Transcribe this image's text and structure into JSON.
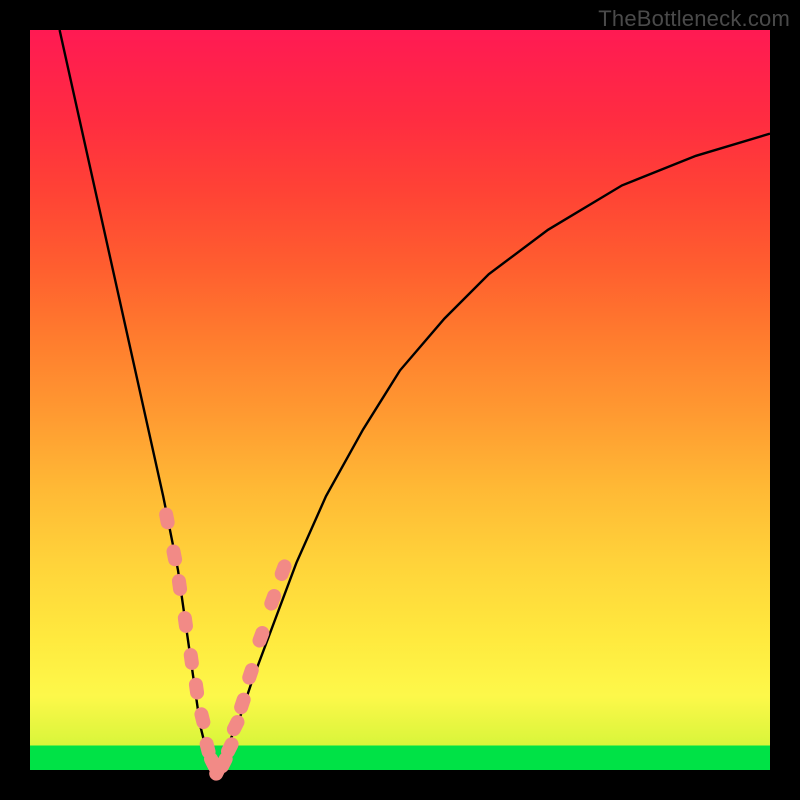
{
  "watermark": "TheBottleneck.com",
  "colors": {
    "background": "#000000",
    "curve": "#000000",
    "pill": "#f28a86",
    "green": "#00e246"
  },
  "chart_data": {
    "type": "line",
    "title": "",
    "xlabel": "",
    "ylabel": "",
    "xlim": [
      0,
      100
    ],
    "ylim": [
      0,
      100
    ],
    "notes": "V-shaped bottleneck curve on red→yellow→green vertical gradient. Pink lozenge markers clustered near the valley on both arms. No tick labels or axis text visible.",
    "series": [
      {
        "name": "curve",
        "x": [
          4,
          6,
          8,
          10,
          12,
          14,
          16,
          18,
          20,
          21,
          22,
          23,
          24,
          25,
          26,
          28,
          30,
          33,
          36,
          40,
          45,
          50,
          56,
          62,
          70,
          80,
          90,
          100
        ],
        "values": [
          100,
          91,
          82,
          73,
          64,
          55,
          46,
          37,
          27,
          20,
          13,
          6,
          2,
          0,
          2,
          6,
          12,
          20,
          28,
          37,
          46,
          54,
          61,
          67,
          73,
          79,
          83,
          86
        ]
      }
    ],
    "markers": {
      "name": "pills",
      "x": [
        18.5,
        19.5,
        20.2,
        21.0,
        21.8,
        22.5,
        23.3,
        24.0,
        24.7,
        25.4,
        26.2,
        27.0,
        27.8,
        28.7,
        29.8,
        31.2,
        32.8,
        34.2
      ],
      "values": [
        34,
        29,
        25,
        20,
        15,
        11,
        7,
        3,
        1,
        0,
        1,
        3,
        6,
        9,
        13,
        18,
        23,
        27
      ]
    }
  }
}
